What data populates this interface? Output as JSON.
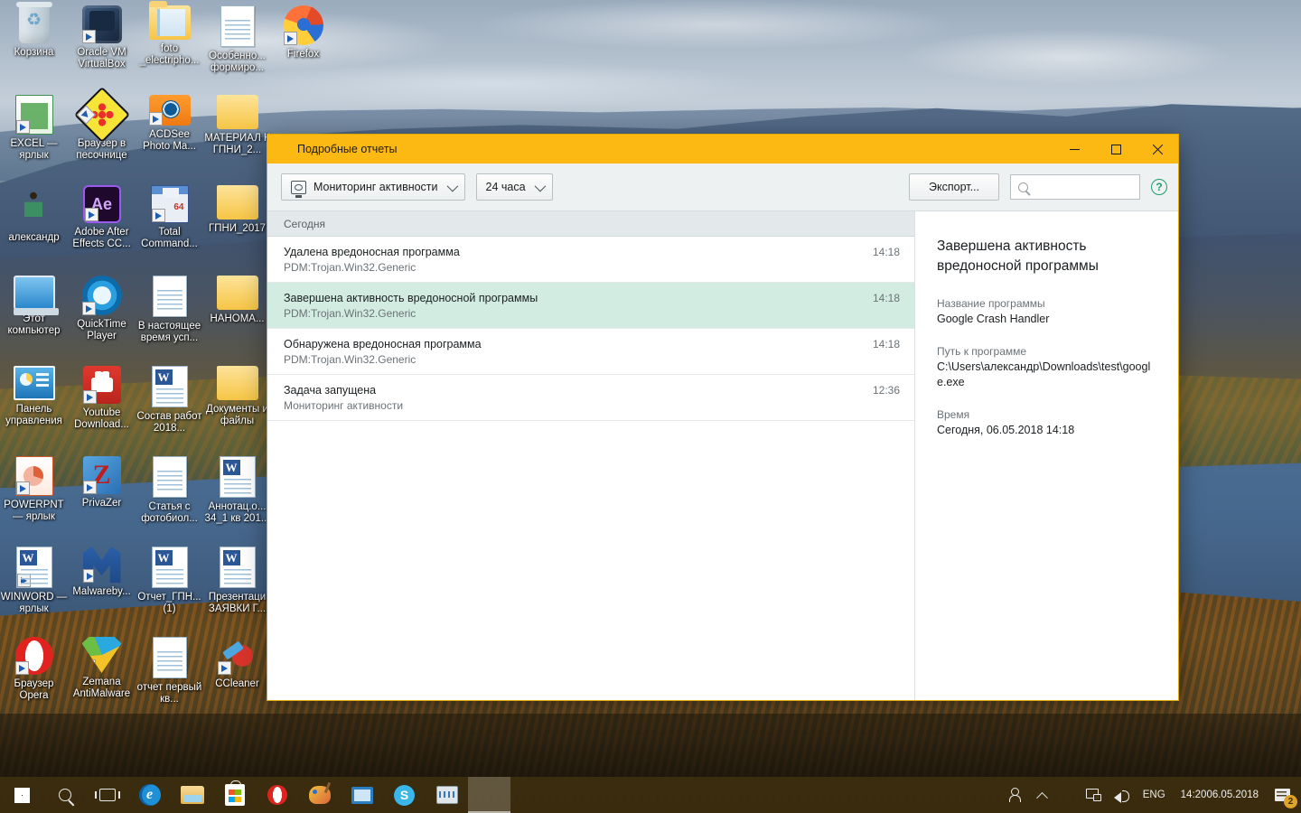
{
  "desktop": {
    "icons": [
      {
        "label": "Корзина",
        "icon": "recycle-bin-icon",
        "art": "ic-trash",
        "shortcut": false,
        "col": 0,
        "row": 0
      },
      {
        "label": "Oracle VM VirtualBox",
        "icon": "virtualbox-icon",
        "art": "ic-vbox",
        "shortcut": true,
        "col": 1,
        "row": 0
      },
      {
        "label": "foto _electripho...",
        "icon": "folder-icon",
        "art": "ic-folder",
        "shortcut": false,
        "col": 2,
        "row": 0
      },
      {
        "label": "Особенно... формиро...",
        "icon": "word-document-icon",
        "art": "ic-doc",
        "shortcut": false,
        "col": 3,
        "row": 0
      },
      {
        "label": "EXCEL — ярлык",
        "icon": "excel-icon",
        "art": "ic-excel",
        "shortcut": true,
        "col": 0,
        "row": 1
      },
      {
        "label": "Браузер в песочнице",
        "icon": "sandboxie-icon",
        "art": "ic-sandbox",
        "shortcut": true,
        "col": 1,
        "row": 1
      },
      {
        "label": "ACDSee Photo Ma...",
        "icon": "acdsee-icon",
        "art": "ic-acdsee",
        "shortcut": true,
        "col": 2,
        "row": 1
      },
      {
        "label": "МАТЕРИАЛ К ГПНИ_2...",
        "icon": "folder-icon",
        "art": "ic-folder2",
        "shortcut": false,
        "col": 3,
        "row": 1
      },
      {
        "label": "александр",
        "icon": "user-folder-icon",
        "art": "ic-folder-user",
        "shortcut": false,
        "col": 0,
        "row": 2
      },
      {
        "label": "Adobe After Effects CC...",
        "icon": "after-effects-icon",
        "art": "ic-ae",
        "shortcut": true,
        "col": 1,
        "row": 2
      },
      {
        "label": "Total Command...",
        "icon": "total-commander-icon",
        "art": "ic-tc",
        "shortcut": true,
        "col": 2,
        "row": 2
      },
      {
        "label": "ГПНИ_2017",
        "icon": "folder-icon",
        "art": "ic-folder2",
        "shortcut": false,
        "col": 3,
        "row": 2
      },
      {
        "label": "Этот компьютер",
        "icon": "this-pc-icon",
        "art": "ic-pc",
        "shortcut": false,
        "col": 0,
        "row": 3
      },
      {
        "label": "QuickTime Player",
        "icon": "quicktime-icon",
        "art": "ic-qt",
        "shortcut": true,
        "col": 1,
        "row": 3
      },
      {
        "label": "В настоящее время усп...",
        "icon": "word-document-icon",
        "art": "ic-doc",
        "shortcut": false,
        "col": 2,
        "row": 3
      },
      {
        "label": "НАНОМА...",
        "icon": "folder-icon",
        "art": "ic-folder2",
        "shortcut": false,
        "col": 3,
        "row": 3
      },
      {
        "label": "Панель управления",
        "icon": "control-panel-icon",
        "art": "ic-ctrlpanel",
        "shortcut": false,
        "col": 0,
        "row": 4
      },
      {
        "label": "Youtube Download...",
        "icon": "youtube-downloader-icon",
        "art": "ic-ytdl",
        "shortcut": true,
        "col": 1,
        "row": 4
      },
      {
        "label": "Состав работ 2018...",
        "icon": "word-document-icon",
        "art": "ic-word",
        "shortcut": false,
        "col": 2,
        "row": 4
      },
      {
        "label": "Документы и файлы",
        "icon": "folder-icon",
        "art": "ic-folder2",
        "shortcut": false,
        "col": 3,
        "row": 4
      },
      {
        "label": "POWERPNT — ярлык",
        "icon": "powerpoint-icon",
        "art": "ic-ppt",
        "shortcut": true,
        "col": 0,
        "row": 5
      },
      {
        "label": "PrivaZer",
        "icon": "privazer-icon",
        "art": "ic-privazer",
        "shortcut": true,
        "col": 1,
        "row": 5
      },
      {
        "label": "Статья с фотобиол...",
        "icon": "word-document-icon",
        "art": "ic-doc",
        "shortcut": false,
        "col": 2,
        "row": 5
      },
      {
        "label": "Аннотац.о... 34_1 кв 201...",
        "icon": "word-document-icon",
        "art": "ic-word",
        "shortcut": false,
        "col": 3,
        "row": 5
      },
      {
        "label": "WINWORD — ярлык",
        "icon": "word-icon",
        "art": "ic-word",
        "shortcut": true,
        "col": 0,
        "row": 6
      },
      {
        "label": "Malwareby...",
        "icon": "malwarebytes-icon",
        "art": "ic-malwarebytes",
        "shortcut": true,
        "col": 1,
        "row": 6
      },
      {
        "label": "Отчет_ГПН... (1)",
        "icon": "word-document-icon",
        "art": "ic-word",
        "shortcut": false,
        "col": 2,
        "row": 6
      },
      {
        "label": "Презентаци ЗАЯВКИ Г...",
        "icon": "word-document-icon",
        "art": "ic-word",
        "shortcut": false,
        "col": 3,
        "row": 6
      },
      {
        "label": "Браузер Opera",
        "icon": "opera-icon",
        "art": "ic-opera",
        "shortcut": true,
        "col": 0,
        "row": 7
      },
      {
        "label": "Zemana AntiMalware",
        "icon": "zemana-icon",
        "art": "ic-zemana",
        "shortcut": true,
        "col": 1,
        "row": 7
      },
      {
        "label": "отчет первый кв...",
        "icon": "word-document-icon",
        "art": "ic-doc",
        "shortcut": false,
        "col": 2,
        "row": 7
      },
      {
        "label": "CCleaner",
        "icon": "ccleaner-icon",
        "art": "ic-ccleaner",
        "shortcut": true,
        "col": 3,
        "row": 7
      }
    ],
    "firefox_icon": {
      "label": "Firefox",
      "icon": "firefox-icon"
    },
    "kaspersky_icon": {
      "icon": "kaspersky-icon"
    }
  },
  "window": {
    "title": "Подробные отчеты",
    "title_icon": "kaspersky-icon",
    "accent_color": "#fdb913",
    "controls": {
      "minimize": "minimize-button",
      "maximize": "maximize-button",
      "close": "close-button"
    },
    "toolbar": {
      "scope_filter": "Мониторинг активности",
      "scope_icon": "monitor-icon",
      "period_filter": "24 часа",
      "export_label": "Экспорт...",
      "search_value": "",
      "search_placeholder": "",
      "search_icon": "search-icon",
      "help_label": "?",
      "help_icon": "help-icon"
    },
    "events": {
      "group_header": "Сегодня",
      "rows": [
        {
          "title": "Удалена вредоносная программа",
          "subtitle": "PDM:Trojan.Win32.Generic",
          "time": "14:18",
          "selected": false
        },
        {
          "title": "Завершена активность вредоносной программы",
          "subtitle": "PDM:Trojan.Win32.Generic",
          "time": "14:18",
          "selected": true
        },
        {
          "title": "Обнаружена вредоносная программа",
          "subtitle": "PDM:Trojan.Win32.Generic",
          "time": "14:18",
          "selected": false
        },
        {
          "title": "Задача запущена",
          "subtitle": "Мониторинг активности",
          "time": "12:36",
          "selected": false
        }
      ],
      "selected_highlight_color": "#d3ece2"
    },
    "details": {
      "title": "Завершена активность вредоносной программы",
      "fields": [
        {
          "label": "Название программы",
          "value": "Google Crash Handler"
        },
        {
          "label": "Путь к программе",
          "value": "C:\\Users\\александр\\Downloads\\test\\google.exe"
        },
        {
          "label": "Время",
          "value": "Сегодня, 06.05.2018 14:18"
        }
      ]
    }
  },
  "taskbar": {
    "start": {
      "icon": "windows-start-icon"
    },
    "search": {
      "icon": "search-icon"
    },
    "task_view": {
      "icon": "task-view-icon"
    },
    "apps": [
      {
        "icon": "edge-icon",
        "art": "ic-edge",
        "active": false
      },
      {
        "icon": "file-explorer-icon",
        "art": "ic-explorer",
        "active": false
      },
      {
        "icon": "microsoft-store-icon",
        "art": "ic-store",
        "active": false
      },
      {
        "icon": "opera-icon",
        "art": "ic-opera-tb",
        "active": false
      },
      {
        "icon": "paint-icon",
        "art": "ic-paint",
        "active": false
      },
      {
        "icon": "windows-mail-icon",
        "art": "ic-winmail",
        "active": false
      },
      {
        "icon": "skype-icon",
        "art": "ic-skype",
        "active": false
      },
      {
        "icon": "system-monitor-icon",
        "art": "ic-monitorapp",
        "active": false
      },
      {
        "icon": "kaspersky-icon",
        "art": "ic-kav-tb",
        "active": true
      }
    ],
    "tray": {
      "people_icon": "people-icon",
      "show_hidden_icon": "chevron-up-icon",
      "kaspersky_icon": "kaspersky-icon",
      "network_icon": "network-icon",
      "volume_icon": "volume-icon",
      "language": "ENG",
      "time": "14:20",
      "date": "06.05.2018",
      "notifications_icon": "action-center-icon",
      "notifications_count": "2"
    }
  }
}
